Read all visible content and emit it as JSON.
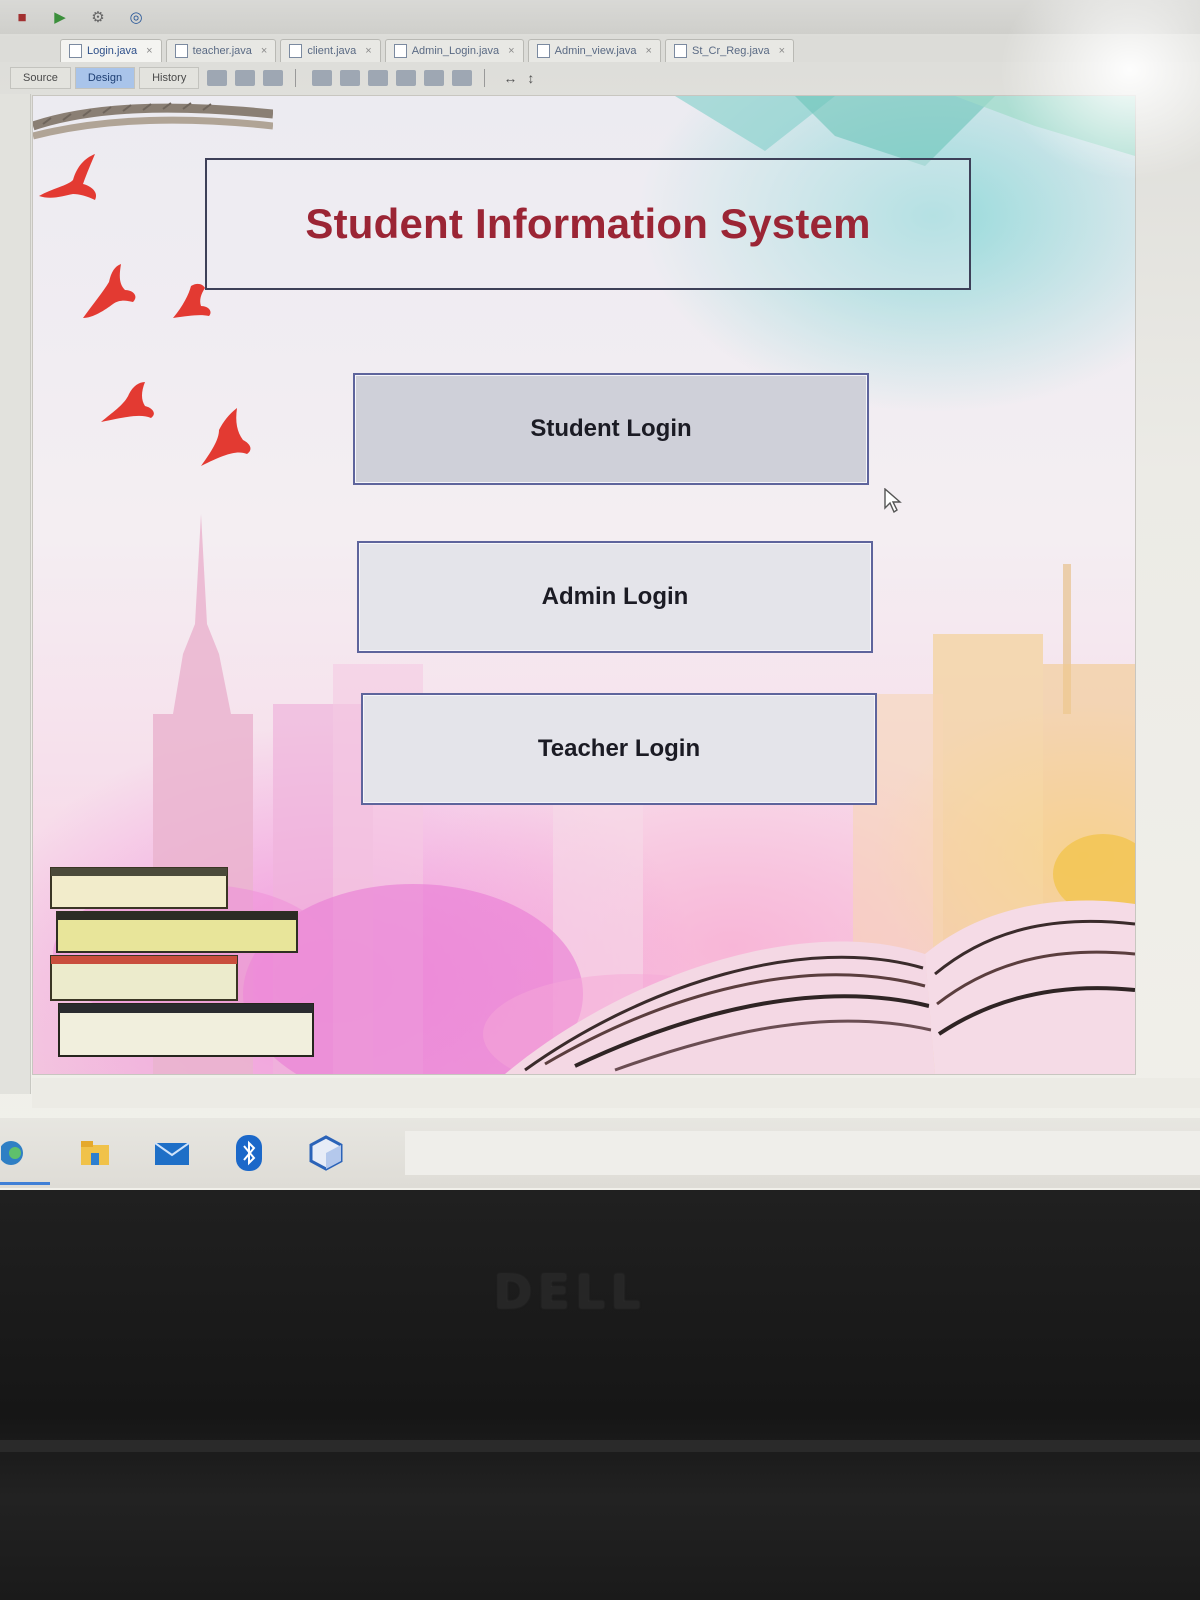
{
  "ide": {
    "tabs": [
      {
        "label": "Login.java",
        "active": true
      },
      {
        "label": "teacher.java",
        "active": false
      },
      {
        "label": "client.java",
        "active": false
      },
      {
        "label": "Admin_Login.java",
        "active": false
      },
      {
        "label": "Admin_view.java",
        "active": false
      },
      {
        "label": "St_Cr_Reg.java",
        "active": false
      }
    ],
    "modes": [
      "Source",
      "Design",
      "History"
    ],
    "active_mode": "Design"
  },
  "app": {
    "title": "Student Information System",
    "buttons": {
      "student": "Student Login",
      "admin": "Admin Login",
      "teacher": "Teacher Login"
    }
  },
  "taskbar": {
    "icons": [
      "edge-icon",
      "file-explorer-icon",
      "mail-icon",
      "bluetooth-icon",
      "cube-app-icon"
    ]
  },
  "laptop": {
    "brand": "DELL"
  },
  "colors": {
    "title_text": "#9b2535",
    "button_border": "#5e649c",
    "bird": "#e33a32"
  }
}
